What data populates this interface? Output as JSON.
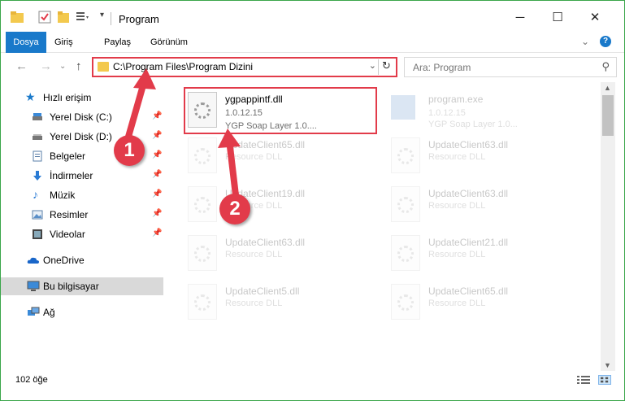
{
  "window": {
    "title": "Program"
  },
  "ribbon": {
    "tabs": [
      "Dosya",
      "Giriş",
      "Paylaş",
      "Görünüm"
    ]
  },
  "nav": {
    "address": "C:\\Program Files\\Program Dizini",
    "search_placeholder": "Ara: Program"
  },
  "sidebar": {
    "items": [
      {
        "label": "Hızlı erişim",
        "icon": "star-icon"
      },
      {
        "label": "Yerel Disk (C:)",
        "icon": "drive-icon"
      },
      {
        "label": "Yerel Disk (D:)",
        "icon": "drive-icon"
      },
      {
        "label": "Belgeler",
        "icon": "document-icon"
      },
      {
        "label": "İndirmeler",
        "icon": "download-icon"
      },
      {
        "label": "Müzik",
        "icon": "music-icon"
      },
      {
        "label": "Resimler",
        "icon": "pictures-icon"
      },
      {
        "label": "Videolar",
        "icon": "video-icon"
      },
      {
        "label": "OneDrive",
        "icon": "cloud-icon"
      },
      {
        "label": "Bu bilgisayar",
        "icon": "computer-icon"
      },
      {
        "label": "Ağ",
        "icon": "network-icon"
      }
    ]
  },
  "files": [
    {
      "name": "ygpappintf.dll",
      "version": "1.0.12.15",
      "desc": "YGP Soap Layer 1.0...."
    },
    {
      "name": "program.exe",
      "version": "1.0.12.15",
      "desc": "YGP Soap Layer 1.0..."
    },
    {
      "name": "UpdateClient65.dll",
      "desc": "Resource DLL"
    },
    {
      "name": "UpdateClient63.dll",
      "desc": "Resource DLL"
    },
    {
      "name": "UpdateClient19.dll",
      "desc": "Resource DLL"
    },
    {
      "name": "UpdateClient63.dll",
      "desc": "Resource DLL"
    },
    {
      "name": "UpdateClient63.dll",
      "desc": "Resource DLL"
    },
    {
      "name": "UpdateClient21.dll",
      "desc": "Resource DLL"
    },
    {
      "name": "UpdateClient5.dll",
      "desc": "Resource DLL"
    },
    {
      "name": "UpdateClient65.dll",
      "desc": "Resource DLL"
    }
  ],
  "status": {
    "count": "102 öğe"
  },
  "callouts": {
    "one": "1",
    "two": "2"
  },
  "colors": {
    "accent": "#1979ca",
    "highlight": "#e23b4a",
    "frame": "#3aa64a"
  }
}
